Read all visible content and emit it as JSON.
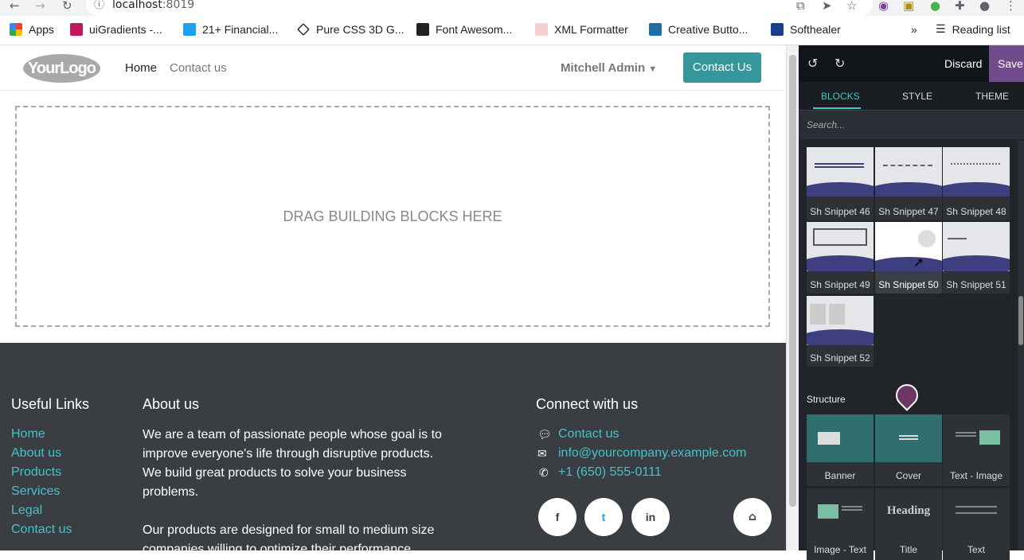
{
  "browser": {
    "url_host": "localhost",
    "url_port": ":8019",
    "bookmarks": [
      {
        "label": "Apps",
        "color": "#e8453c"
      },
      {
        "label": "uiGradients -...",
        "color": "#c2185b"
      },
      {
        "label": "21+ Financial...",
        "color": "#1da1f2"
      },
      {
        "label": "Pure CSS 3D G...",
        "color": "#222222"
      },
      {
        "label": "Font Awesom...",
        "color": "#222222"
      },
      {
        "label": "XML Formatter",
        "color": "#d9534f"
      },
      {
        "label": "Creative Butto...",
        "color": "#1e6fa8"
      },
      {
        "label": "Softhealer",
        "color": "#1a3e8c"
      }
    ],
    "more_label": "»",
    "reading_list": "Reading list"
  },
  "site": {
    "logo": "YourLogo",
    "nav_home": "Home",
    "nav_contact": "Contact us",
    "user": "Mitchell Admin",
    "contact_button": "Contact Us",
    "dropzone_text": "DRAG BUILDING BLOCKS HERE"
  },
  "footer": {
    "useful_links_title": "Useful Links",
    "links": [
      "Home",
      "About us",
      "Products",
      "Services",
      "Legal",
      "Contact us"
    ],
    "about_title": "About us",
    "about_p1_lines": [
      "We are a team of passionate people whose goal is to",
      "improve everyone's life through disruptive products.",
      "We build great products to solve your business",
      "problems."
    ],
    "about_p2_lines": [
      "Our products are designed for small to medium size",
      "companies willing to optimize their performance."
    ],
    "connect_title": "Connect with us",
    "contact_link": "Contact us",
    "email": "info@yourcompany.example.com",
    "phone": "+1 (650) 555-0111",
    "social": [
      "f",
      "t",
      "in",
      "⌂"
    ]
  },
  "editor": {
    "discard": "Discard",
    "save": "Save",
    "tabs": [
      "BLOCKS",
      "STYLE",
      "THEME"
    ],
    "search_placeholder": "Search...",
    "snippets": [
      "Sh Snippet 46",
      "Sh Snippet 47",
      "Sh Snippet 48",
      "Sh Snippet 49",
      "Sh Snippet 50",
      "Sh Snippet 51",
      "Sh Snippet 52"
    ],
    "structure_title": "Structure",
    "structure_blocks": [
      "Banner",
      "Cover",
      "Text - Image",
      "Image - Text",
      "Title",
      "Text"
    ],
    "heading_thumb_text": "Heading",
    "accent": "#42c4c9",
    "save_color": "#714b8a"
  }
}
